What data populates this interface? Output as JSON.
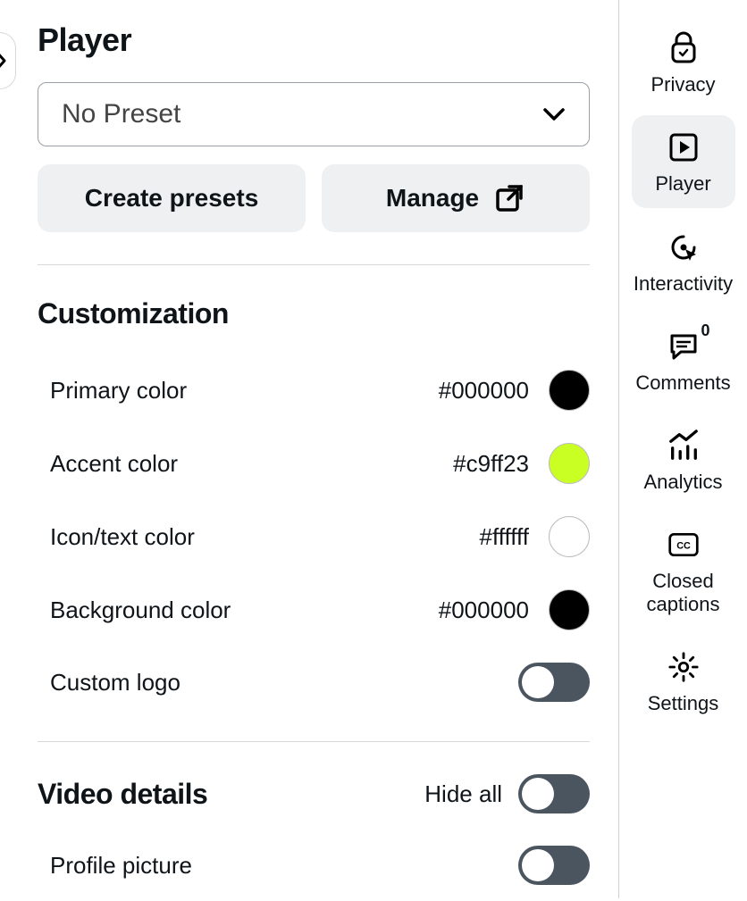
{
  "header": {
    "title": "Player"
  },
  "preset": {
    "selected": "No Preset"
  },
  "buttons": {
    "create": "Create presets",
    "manage": "Manage"
  },
  "customization": {
    "title": "Customization",
    "primary": {
      "label": "Primary color",
      "hex": "#000000",
      "swatch": "#000000"
    },
    "accent": {
      "label": "Accent color",
      "hex": "#c9ff23",
      "swatch": "#c9ff23"
    },
    "icontext": {
      "label": "Icon/text color",
      "hex": "#ffffff",
      "swatch": "#ffffff"
    },
    "background": {
      "label": "Background color",
      "hex": "#000000",
      "swatch": "#000000"
    },
    "custom_logo": {
      "label": "Custom logo",
      "on": false
    }
  },
  "video_details": {
    "title": "Video details",
    "hide_all": {
      "label": "Hide all",
      "on": false
    },
    "profile_picture": {
      "label": "Profile picture",
      "on": false
    }
  },
  "rail": {
    "privacy": {
      "label": "Privacy"
    },
    "player": {
      "label": "Player"
    },
    "interactivity": {
      "label": "Interactivity"
    },
    "comments": {
      "label": "Comments",
      "count": "0"
    },
    "analytics": {
      "label": "Analytics"
    },
    "cc": {
      "label": "Closed captions"
    },
    "settings": {
      "label": "Settings"
    }
  }
}
